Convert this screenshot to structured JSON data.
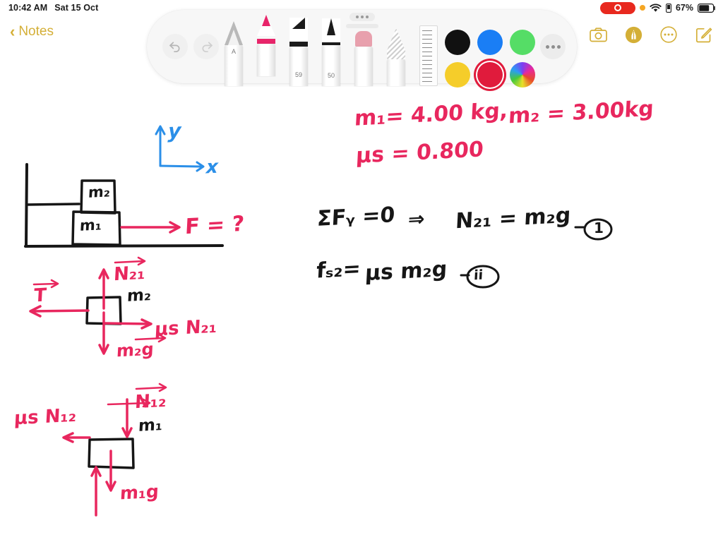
{
  "statusbar": {
    "time": "10:42 AM",
    "date": "Sat 15 Oct",
    "battery_pct": "67%",
    "recording_icon": "screen-record-pill",
    "orange_dot_icon": "mic-in-use-dot",
    "wifi_icon": "wifi-icon",
    "battery_icon": "battery-icon"
  },
  "navbar": {
    "back_label": "Notes",
    "back_chevron": "‹",
    "icons": [
      {
        "name": "camera-icon",
        "label": "Camera"
      },
      {
        "name": "markup-pen-icon",
        "label": "Markup"
      },
      {
        "name": "more-ellipsis-icon",
        "label": "More"
      },
      {
        "name": "compose-note-icon",
        "label": "New Note"
      }
    ]
  },
  "toolbar": {
    "drag_handle_icon": "drag-handle-dots",
    "undo_label": "Undo",
    "redo_label": "Redo",
    "more_tools_label": "More",
    "tools": [
      {
        "name": "pencil-tool",
        "label": "A",
        "selected": false
      },
      {
        "name": "pen-tool",
        "label": "",
        "selected": true
      },
      {
        "name": "marker-tool",
        "label": "59",
        "selected": false
      },
      {
        "name": "brush-tool",
        "label": "50",
        "selected": false
      },
      {
        "name": "eraser-tool",
        "label": "",
        "selected": false
      },
      {
        "name": "lasso-tool",
        "label": "",
        "selected": false
      },
      {
        "name": "ruler-tool",
        "label": "",
        "selected": false
      }
    ],
    "colors": [
      {
        "name": "color-black",
        "hex": "#111111",
        "selected": false
      },
      {
        "name": "color-blue",
        "hex": "#1a7ef5",
        "selected": false
      },
      {
        "name": "color-green",
        "hex": "#55dd66",
        "selected": false
      },
      {
        "name": "color-yellow",
        "hex": "#f5cd2a",
        "selected": false
      },
      {
        "name": "color-red",
        "hex": "#e01b3c",
        "selected": true
      },
      {
        "name": "color-picker",
        "hex": "rainbow",
        "selected": false
      }
    ]
  },
  "note": {
    "givens": {
      "line1": "m₁= 4.00 kg,",
      "line1b": "m₂ = 3.00kg",
      "line2": "μs = 0.800"
    },
    "equations": {
      "eq1_left": "ΣFᵧ =0",
      "eq1_arrow": "⇒",
      "eq1_right": "N₂₁ = m₂g",
      "eq1_tag": "①",
      "eq1_dash": "-",
      "eq2_left": "fₛ₂=",
      "eq2_right": "μs m₂g",
      "eq2_dash": "-",
      "eq2_tag": "ii"
    },
    "diagram1": {
      "name": "stacked-blocks-setup",
      "block_top": "m₂",
      "block_bottom": "m₁",
      "force_label": "F = ?",
      "axis_y": "y",
      "axis_x": "x"
    },
    "diagram2": {
      "name": "free-body-diagram-m2",
      "mass_label": "m₂",
      "normal": "N₂₁",
      "tension": "T",
      "friction": "μs N₂₁",
      "weight": "m₂g"
    },
    "diagram3": {
      "name": "free-body-diagram-m1",
      "mass_label": "m₁",
      "normal": "N₁₂",
      "friction": "μs N₁₂",
      "weight": "m₁g"
    }
  }
}
